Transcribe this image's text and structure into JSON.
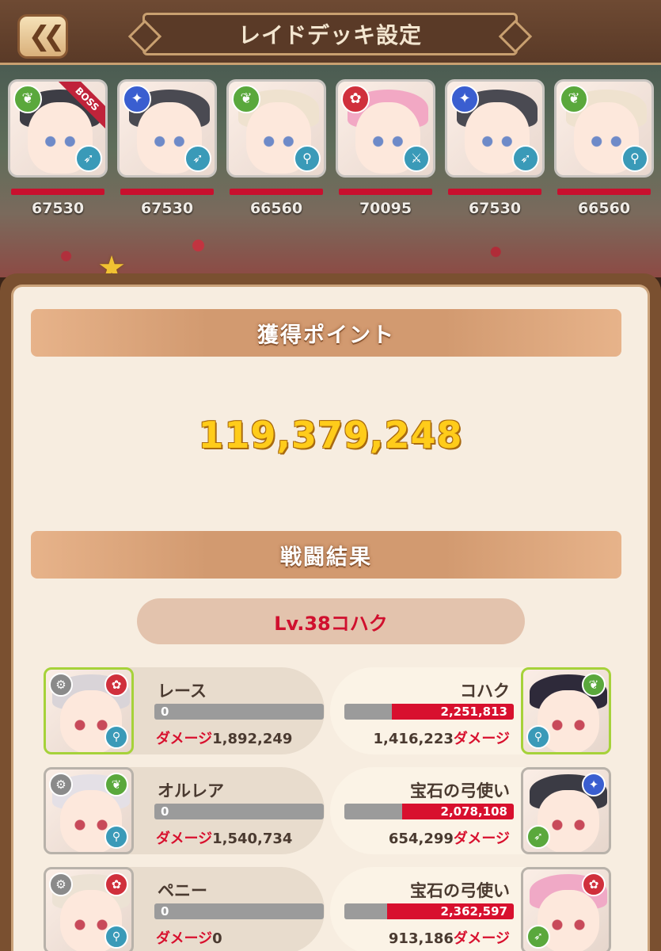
{
  "header": {
    "title": "レイドデッキ設定",
    "back_icon": "double-chevron-left-icon"
  },
  "party": {
    "boss_label": "BOSS",
    "members": [
      {
        "power": "67530",
        "element": "leaf",
        "class": "bow",
        "hair": "#3d3d45",
        "boss": true
      },
      {
        "power": "67530",
        "element": "wind",
        "class": "bow",
        "hair": "#4a4a52"
      },
      {
        "power": "66560",
        "element": "leaf",
        "class": "wand",
        "hair": "#efe2cf"
      },
      {
        "power": "70095",
        "element": "fire",
        "class": "sword",
        "hair": "#f2a8c4"
      },
      {
        "power": "67530",
        "element": "wind",
        "class": "bow",
        "hair": "#4a4a52"
      },
      {
        "power": "66560",
        "element": "leaf",
        "class": "wand",
        "hair": "#efe2cf"
      }
    ]
  },
  "points": {
    "header": "獲得ポイント",
    "value": "119,379,248"
  },
  "battle": {
    "header": "戦闘結果",
    "enemy_label": "Lv.38コハク",
    "damage_label": "ダメージ",
    "rows": [
      {
        "ally": {
          "name": "レース",
          "hp": "0",
          "damage": "1,892,249",
          "hair": "#d9d4d8"
        },
        "enemy": {
          "name": "コハク",
          "hp": "2,251,813",
          "hp_fraction": 0.72,
          "damage": "1,416,223",
          "hair": "#2e2a3a"
        }
      },
      {
        "ally": {
          "name": "オルレア",
          "hp": "0",
          "damage": "1,540,734",
          "hair": "#e4e0e6"
        },
        "enemy": {
          "name": "宝石の弓使い",
          "hp": "2,078,108",
          "hp_fraction": 0.66,
          "damage": "654,299",
          "hair": "#3b3b44"
        }
      },
      {
        "ally": {
          "name": "ペニー",
          "hp": "0",
          "damage": "0",
          "hair": "#ece2d4"
        },
        "enemy": {
          "name": "宝石の弓使い",
          "hp": "2,362,597",
          "hp_fraction": 0.75,
          "damage": "913,186",
          "hair": "#f0a9c6"
        }
      }
    ]
  },
  "colors": {
    "leaf": "#5aa83c",
    "wind": "#3a5ed0",
    "fire": "#d0303c",
    "class": "#3a9ab8",
    "hp": "#d8102e",
    "points": "#ffcc1a"
  }
}
